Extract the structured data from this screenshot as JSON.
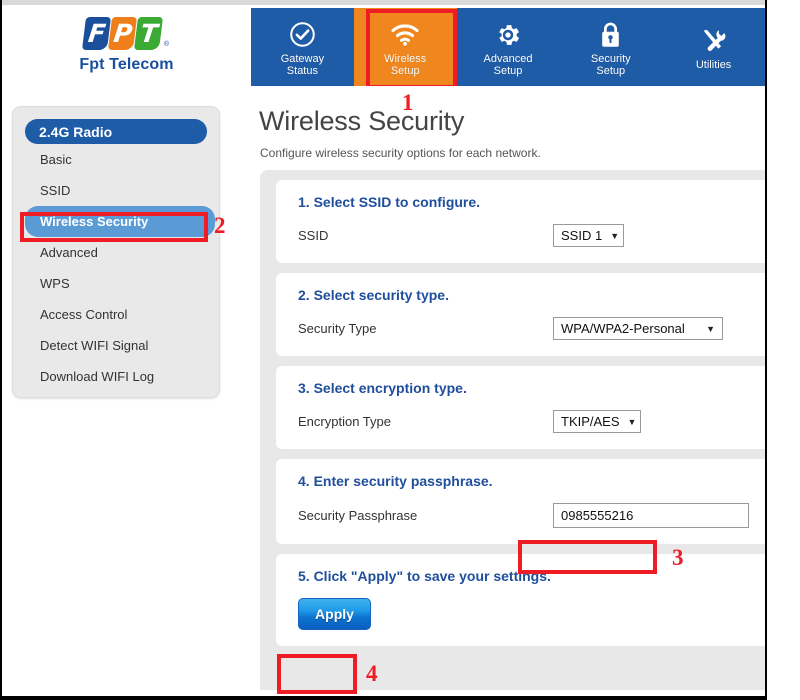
{
  "brand": {
    "logo_letters": [
      "F",
      "P",
      "T"
    ],
    "registered_mark": "®",
    "name": "Fpt Telecom"
  },
  "nav": {
    "items": [
      {
        "label": "Gateway\nStatus",
        "icon": "check-circle-icon",
        "active": false
      },
      {
        "label": "Wireless\nSetup",
        "icon": "wifi-icon",
        "active": true
      },
      {
        "label": "Advanced\nSetup",
        "icon": "gear-icon",
        "active": false
      },
      {
        "label": "Security\nSetup",
        "icon": "lock-icon",
        "active": false
      },
      {
        "label": "Utilities",
        "icon": "tools-icon",
        "active": false
      }
    ]
  },
  "sidebar": {
    "header": "2.4G Radio",
    "items": [
      {
        "label": "Basic",
        "selected": false
      },
      {
        "label": "SSID",
        "selected": false
      },
      {
        "label": "Wireless Security",
        "selected": true
      },
      {
        "label": "Advanced",
        "selected": false
      },
      {
        "label": "WPS",
        "selected": false
      },
      {
        "label": "Access Control",
        "selected": false
      },
      {
        "label": "Detect WIFI Signal",
        "selected": false
      },
      {
        "label": "Download WIFI Log",
        "selected": false
      }
    ]
  },
  "page": {
    "title": "Wireless Security",
    "subtitle": "Configure wireless security options for each network."
  },
  "sections": {
    "ssid": {
      "title": "1. Select SSID to configure.",
      "field_label": "SSID",
      "value": "SSID 1"
    },
    "security_type": {
      "title": "2. Select security type.",
      "field_label": "Security Type",
      "value": "WPA/WPA2-Personal"
    },
    "encryption_type": {
      "title": "3. Select encryption type.",
      "field_label": "Encryption Type",
      "value": "TKIP/AES"
    },
    "passphrase": {
      "title": "4. Enter security passphrase.",
      "field_label": "Security Passphrase",
      "value": "0985555216"
    },
    "apply": {
      "title": "5. Click \"Apply\" to save your settings.",
      "button_label": "Apply"
    }
  },
  "annotations": {
    "step1": "1",
    "step2": "2",
    "step3": "3",
    "step4": "4",
    "color": "#ee1c25"
  },
  "colors": {
    "nav_blue": "#1f5ca8",
    "active_orange": "#f0871e",
    "sidebar_bg": "#e9e9e9",
    "selected_blue": "#5b9bd5",
    "heading_blue": "#1f4e9c"
  }
}
